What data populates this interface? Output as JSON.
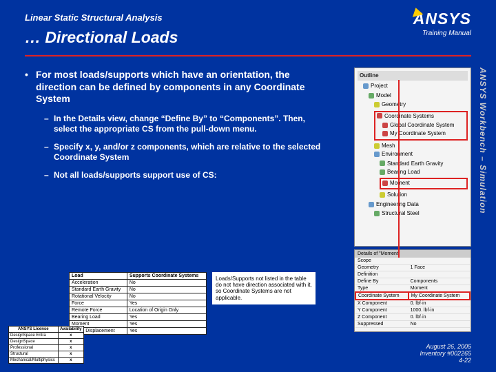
{
  "header": {
    "supertitle": "Linear Static Structural Analysis",
    "title": "… Directional Loads",
    "logo_main": "ANSYS",
    "logo_sub": "Training Manual"
  },
  "sidetext": "ANSYS Workbench – Simulation",
  "bullets": {
    "main": "For most loads/supports which have an orientation, the direction can be defined by components in any Coordinate System",
    "sub": [
      "In the Details view, change “Define By” to “Components”.  Then, select the appropriate CS from the pull-down menu.",
      "Specify x, y, and/or z components, which are relative to the selected Coordinate System",
      "Not all loads/supports support use of CS:"
    ]
  },
  "tree": {
    "header": "Outline",
    "root": "Project",
    "model": "Model",
    "geometry": "Geometry",
    "cs_group": "Coordinate Systems",
    "cs_items": [
      "Global Coordinate System",
      "My Coordinate System"
    ],
    "mesh": "Mesh",
    "env": "Environment",
    "env_items": [
      "Standard Earth Gravity",
      "Bearing Load",
      "Moment",
      "Solution"
    ],
    "eng": "Engineering Data",
    "eng_item": "Structural Steel"
  },
  "details": {
    "header": "Details of \"Moment\"",
    "rows": [
      [
        "Scope",
        ""
      ],
      [
        "Geometry",
        "1 Face"
      ],
      [
        "Definition",
        ""
      ],
      [
        "Define By",
        "Components"
      ],
      [
        "Type",
        "Moment"
      ],
      [
        "Coordinate System",
        "My Coordinate System"
      ],
      [
        "X Component",
        "0. lbf·in"
      ],
      [
        "Y Component",
        "1000. lbf·in"
      ],
      [
        "Z Component",
        "0. lbf·in"
      ],
      [
        "Suppressed",
        "No"
      ]
    ]
  },
  "support_table": {
    "headers": [
      "Load",
      "Supports Coordinate Systems"
    ],
    "rows": [
      [
        "Acceleration",
        "No"
      ],
      [
        "Standard Earth Gravity",
        "No"
      ],
      [
        "Rotational Velocity",
        "No"
      ],
      [
        "Force",
        "Yes"
      ],
      [
        "Remote Force",
        "Location of Origin Only"
      ],
      [
        "Bearing Load",
        "Yes"
      ],
      [
        "Moment",
        "Yes"
      ],
      [
        "Given Displacement",
        "Yes"
      ]
    ]
  },
  "lic_table": {
    "headers": [
      "ANSYS License",
      "Availability"
    ],
    "rows": [
      [
        "DesignSpace Entra",
        "x"
      ],
      [
        "DesignSpace",
        "x"
      ],
      [
        "Professional",
        "x"
      ],
      [
        "Structural",
        "x"
      ],
      [
        "Mechanical/Multiphysics",
        "x"
      ]
    ]
  },
  "note": "Loads/Supports not listed in the table do not have direction associated with it, so Coordinate Systems are not applicable.",
  "footer": {
    "date": "August 26, 2005",
    "inv": "Inventory #002265",
    "page": "4-22"
  }
}
